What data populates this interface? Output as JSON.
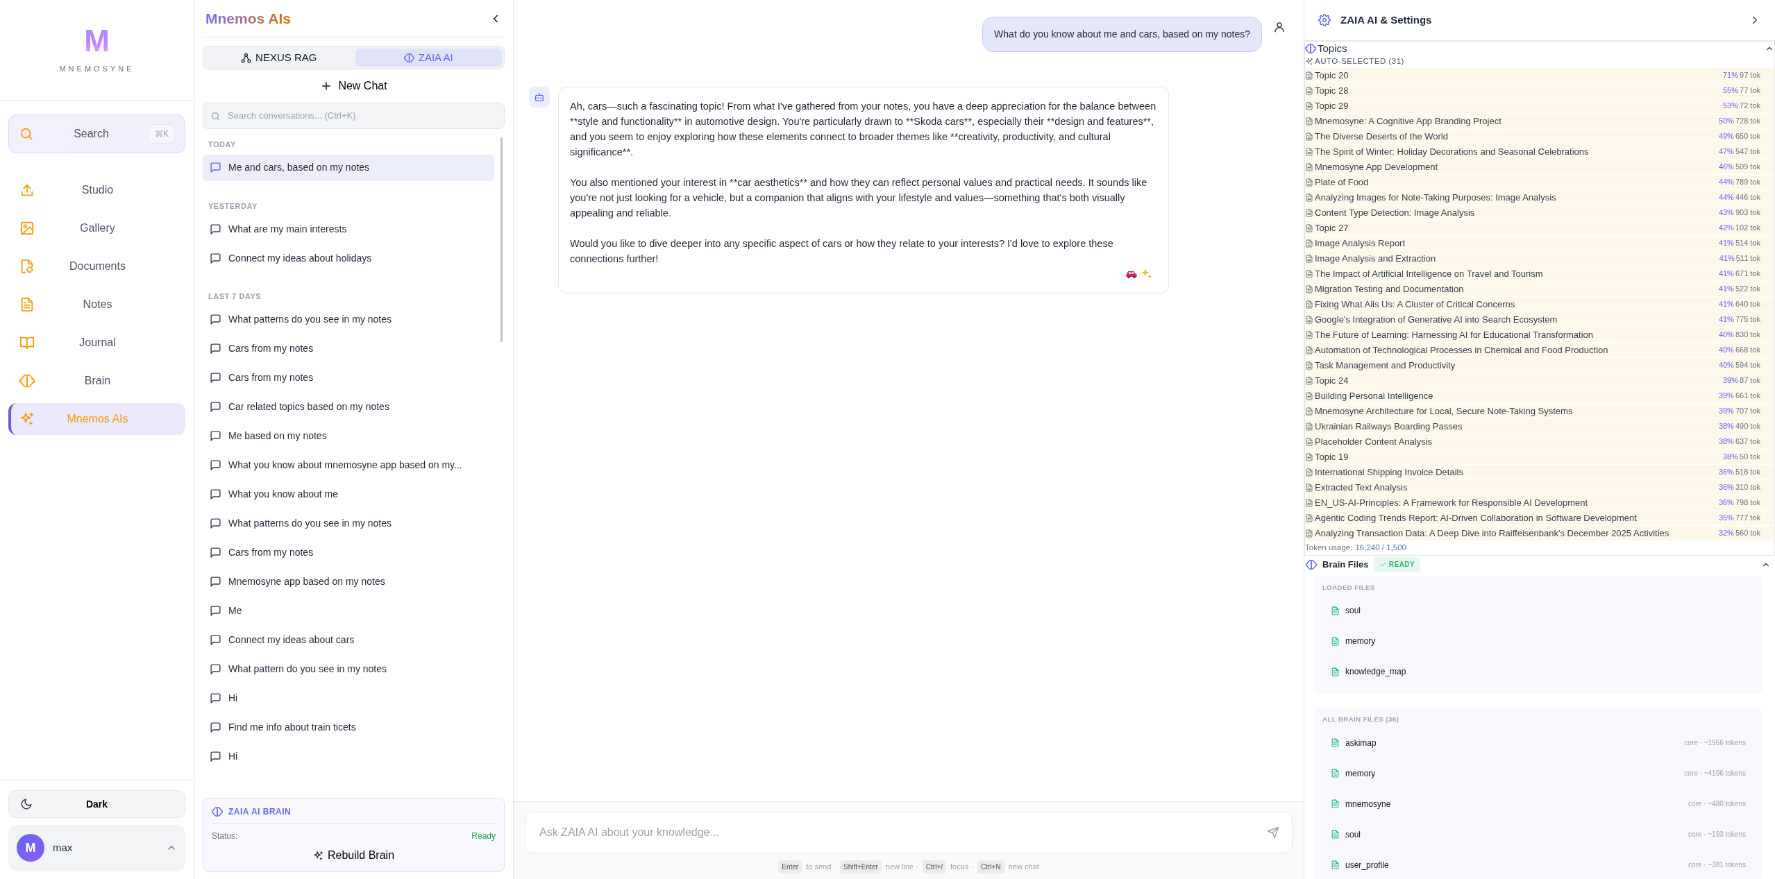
{
  "sidebar": {
    "logo_letter": "M",
    "logo_text": "MNEMOSYNE",
    "search": {
      "label": "Search",
      "shortcut": "⌘K"
    },
    "items": [
      {
        "label": "Studio",
        "selected": false
      },
      {
        "label": "Gallery",
        "selected": false
      },
      {
        "label": "Documents",
        "selected": false
      },
      {
        "label": "Notes",
        "selected": false
      },
      {
        "label": "Journal",
        "selected": false
      },
      {
        "label": "Brain",
        "selected": false
      },
      {
        "label": "Mnemos AIs",
        "selected": true
      }
    ],
    "theme_button": "Dark",
    "user": {
      "initial": "M",
      "name": "max"
    }
  },
  "chat_panel": {
    "title": "Mnemos AIs",
    "modes": [
      {
        "label": "NEXUS RAG",
        "selected": false
      },
      {
        "label": "ZAIA AI",
        "selected": true
      }
    ],
    "new_chat": "New Chat",
    "search": {
      "placeholder": "Search conversations... (Ctrl+K)"
    },
    "groups": [
      {
        "heading": "TODAY",
        "chats": [
          {
            "title": "Me and cars, based on my notes",
            "selected": true
          }
        ]
      },
      {
        "heading": "YESTERDAY",
        "chats": [
          {
            "title": "What are my main interests",
            "selected": false
          },
          {
            "title": "Connect my ideas about holidays",
            "selected": false
          }
        ]
      },
      {
        "heading": "LAST 7 DAYS",
        "chats": [
          {
            "title": "What patterns do you see in my notes",
            "selected": false
          },
          {
            "title": "Cars from my notes",
            "selected": false
          },
          {
            "title": "Cars from my notes",
            "selected": false
          },
          {
            "title": "Car related topics based on my notes",
            "selected": false
          },
          {
            "title": "Me based on my notes",
            "selected": false
          },
          {
            "title": "What you know about mnemosyne app based on my...",
            "selected": false
          },
          {
            "title": "What you know about me",
            "selected": false
          },
          {
            "title": "What patterns do you see in my notes",
            "selected": false
          },
          {
            "title": "Cars from my notes",
            "selected": false
          },
          {
            "title": "Mnemosyne app based on my notes",
            "selected": false
          },
          {
            "title": "Me",
            "selected": false
          },
          {
            "title": "Connect my ideas about cars",
            "selected": false
          },
          {
            "title": "What pattern do you see in my notes",
            "selected": false
          },
          {
            "title": "Hi",
            "selected": false
          },
          {
            "title": "Find me info about train ticets",
            "selected": false
          },
          {
            "title": "Hi",
            "selected": false
          }
        ]
      }
    ],
    "brain": {
      "title": "ZAIA AI BRAIN",
      "status_label": "Status:",
      "status": "Ready",
      "button": "Rebuild Brain"
    }
  },
  "conversation": {
    "messages": [
      {
        "kind": "user",
        "paragraphs": [
          "What do you know about me and cars, based on my notes?"
        ]
      },
      {
        "kind": "assistant",
        "paragraphs": [
          "Ah, cars—such a fascinating topic! From what I've gathered from your notes, you have a deep appreciation for the balance between **style and functionality** in automotive design. You're particularly drawn to **Skoda cars**, especially their **design and features**, and you seem to enjoy exploring how these elements connect to broader themes like **creativity, productivity, and cultural significance**.",
          "You also mentioned your interest in **car aesthetics** and how they can reflect personal values and practical needs. It sounds like you're not just looking for a vehicle, but a companion that aligns with your lifestyle and values—something that's both visually appealing and reliable.",
          "Would you like to dive deeper into any specific aspect of cars or how they relate to your interests? I'd love to explore these connections further!"
        ]
      }
    ],
    "input": {
      "placeholder": "Ask ZAIA AI about your knowledge..."
    },
    "hints": [
      {
        "key": "Enter",
        "text": "to send ·"
      },
      {
        "key": "Shift+Enter",
        "text": "new line ·"
      },
      {
        "key": "Ctrl+/",
        "text": "focus ·"
      },
      {
        "key": "Ctrl+N",
        "text": "new chat"
      }
    ]
  },
  "settings_panel": {
    "title": "ZAIA AI & Settings",
    "topics": {
      "title": "Topics",
      "expanded": true,
      "auto_label": "AUTO-SELECTED (31)",
      "items": [
        {
          "title": "Topic 20",
          "score": "71%",
          "tokens": "97 tok"
        },
        {
          "title": "Topic 28",
          "score": "55%",
          "tokens": "77 tok"
        },
        {
          "title": "Topic 29",
          "score": "53%",
          "tokens": "72 tok"
        },
        {
          "title": "Mnemosyne: A Cognitive App Branding Project",
          "score": "50%",
          "tokens": "728 tok"
        },
        {
          "title": "The Diverse Deserts of the World",
          "score": "49%",
          "tokens": "650 tok"
        },
        {
          "title": "The Spirit of Winter: Holiday Decorations and Seasonal Celebrations",
          "score": "47%",
          "tokens": "547 tok"
        },
        {
          "title": "Mnemosyne App Development",
          "score": "46%",
          "tokens": "509 tok"
        },
        {
          "title": "Plate of Food",
          "score": "44%",
          "tokens": "789 tok"
        },
        {
          "title": "Analyzing Images for Note-Taking Purposes: Image Analysis",
          "score": "44%",
          "tokens": "446 tok"
        },
        {
          "title": "Content Type Detection: Image Analysis",
          "score": "43%",
          "tokens": "903 tok"
        },
        {
          "title": "Topic 27",
          "score": "42%",
          "tokens": "102 tok"
        },
        {
          "title": "Image Analysis Report",
          "score": "41%",
          "tokens": "514 tok"
        },
        {
          "title": "Image Analysis and Extraction",
          "score": "41%",
          "tokens": "511 tok"
        },
        {
          "title": "The Impact of Artificial Intelligence on Travel and Tourism",
          "score": "41%",
          "tokens": "671 tok"
        },
        {
          "title": "Migration Testing and Documentation",
          "score": "41%",
          "tokens": "522 tok"
        },
        {
          "title": "Fixing What Ails Us: A Cluster of Critical Concerns",
          "score": "41%",
          "tokens": "640 tok"
        },
        {
          "title": "Google's Integration of Generative AI into Search Ecosystem",
          "score": "41%",
          "tokens": "775 tok"
        },
        {
          "title": "The Future of Learning: Harnessing AI for Educational Transformation",
          "score": "40%",
          "tokens": "830 tok"
        },
        {
          "title": "Automation of Technological Processes in Chemical and Food Production",
          "score": "40%",
          "tokens": "668 tok"
        },
        {
          "title": "Task Management and Productivity",
          "score": "40%",
          "tokens": "594 tok"
        },
        {
          "title": "Topic 24",
          "score": "39%",
          "tokens": "87 tok"
        },
        {
          "title": "Building Personal Intelligence",
          "score": "39%",
          "tokens": "661 tok"
        },
        {
          "title": "Mnemosyne Architecture for Local, Secure Note-Taking Systems",
          "score": "39%",
          "tokens": "707 tok"
        },
        {
          "title": "Ukrainian Railways Boarding Passes",
          "score": "38%",
          "tokens": "490 tok"
        },
        {
          "title": "Placeholder Content Analysis",
          "score": "38%",
          "tokens": "637 tok"
        },
        {
          "title": "Topic 19",
          "score": "38%",
          "tokens": "50 tok"
        },
        {
          "title": "International Shipping Invoice Details",
          "score": "36%",
          "tokens": "518 tok"
        },
        {
          "title": "Extracted Text Analysis",
          "score": "36%",
          "tokens": "310 tok"
        },
        {
          "title": "EN_US-AI-Principles: A Framework for Responsible AI Development",
          "score": "36%",
          "tokens": "798 tok"
        },
        {
          "title": "Agentic Coding Trends Report: AI-Driven Collaboration in Software Development",
          "score": "35%",
          "tokens": "777 tok"
        },
        {
          "title": "Analyzing Transaction Data: A Deep Dive into Raiffeisenbank's December 2025 Activities",
          "score": "32%",
          "tokens": "560 tok"
        }
      ],
      "token_usage_label": "Token usage:",
      "token_usage": "16,240 / 1,500"
    },
    "brain_files": {
      "title": "Brain Files",
      "status": "READY",
      "expanded": true,
      "loaded": {
        "heading": "LOADED FILES",
        "files": [
          {
            "name": "soul"
          },
          {
            "name": "memory"
          },
          {
            "name": "knowledge_map"
          }
        ]
      },
      "all": {
        "heading": "ALL BRAIN FILES (36)",
        "files": [
          {
            "name": "askimap",
            "meta": "core · ~1966 tokens"
          },
          {
            "name": "memory",
            "meta": "core · ~4196 tokens"
          },
          {
            "name": "mnemosyne",
            "meta": "core · ~480 tokens"
          },
          {
            "name": "soul",
            "meta": "core · ~193 tokens"
          },
          {
            "name": "user_profile",
            "meta": "core · ~381 tokens"
          }
        ]
      }
    }
  }
}
